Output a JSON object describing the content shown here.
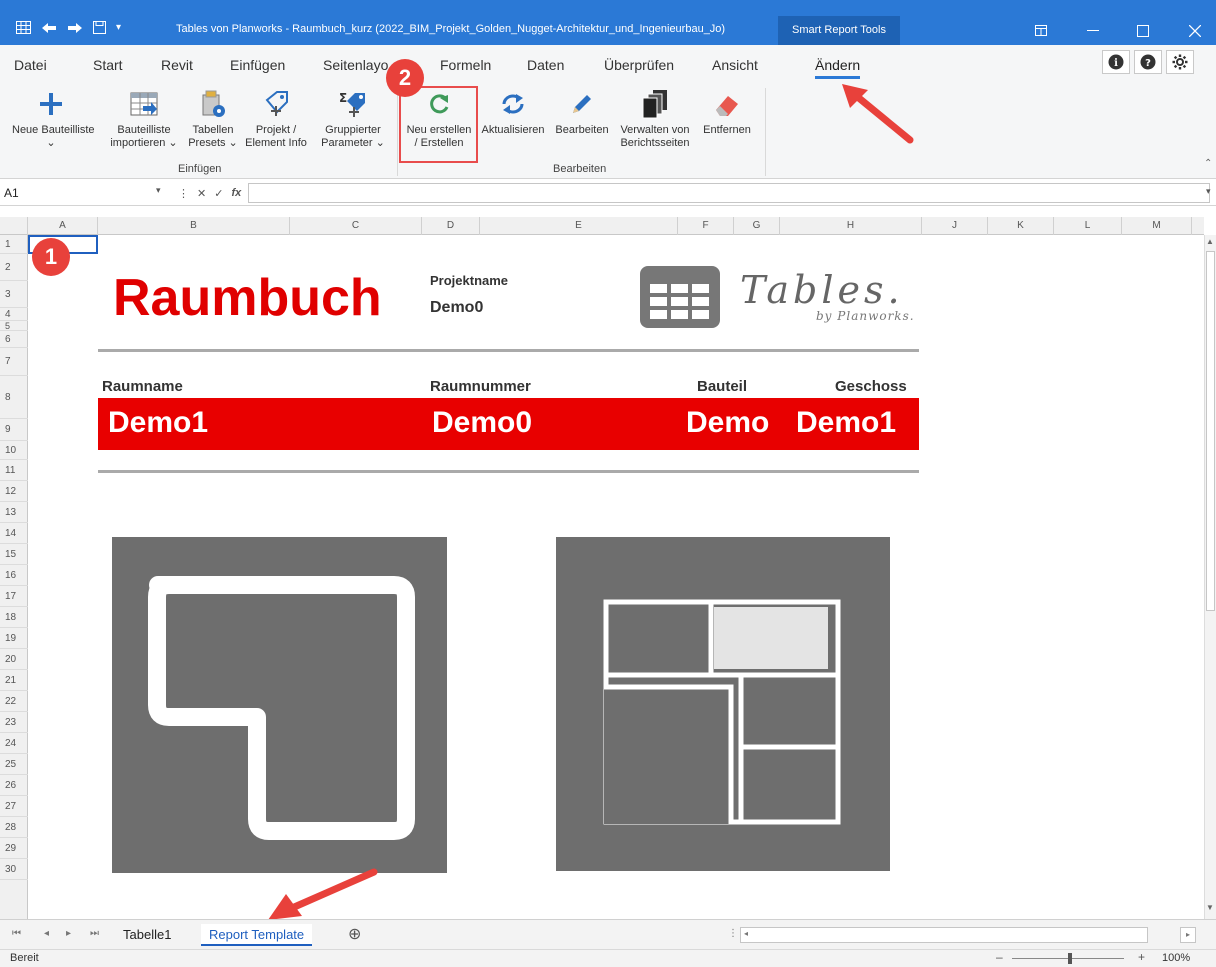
{
  "window": {
    "title": "Tables von Planworks - Raumbuch_kurz  (2022_BIM_Projekt_Golden_Nugget-Architektur_und_Ingenieurbau_Jo)",
    "context_tab": "Smart Report Tools"
  },
  "ribbon_tabs": [
    "Datei",
    "Start",
    "Revit",
    "Einfügen",
    "Seitenlayo",
    "Formeln",
    "Daten",
    "Überprüfen",
    "Ansicht",
    "Ändern"
  ],
  "active_tab": "Ändern",
  "groups": {
    "einfuegen": {
      "label": "Einfügen",
      "buttons": [
        {
          "line1": "Neue Bauteilliste",
          "line2": "⌄"
        },
        {
          "line1": "Bauteilliste",
          "line2": "importieren ⌄"
        },
        {
          "line1": "Tabellen",
          "line2": "Presets ⌄"
        },
        {
          "line1": "Projekt /",
          "line2": "Element Info"
        },
        {
          "line1": "Gruppierter",
          "line2": "Parameter ⌄"
        }
      ]
    },
    "bearbeiten": {
      "label": "Bearbeiten",
      "buttons": [
        {
          "line1": "Neu erstellen",
          "line2": "/ Erstellen"
        },
        {
          "line1": "Aktualisieren",
          "line2": ""
        },
        {
          "line1": "Bearbeiten",
          "line2": ""
        },
        {
          "line1": "Verwalten von",
          "line2": "Berichtsseiten"
        },
        {
          "line1": "Entfernen",
          "line2": ""
        }
      ]
    }
  },
  "formula_bar": {
    "name_box": "A1",
    "formula": ""
  },
  "columns": [
    "A",
    "B",
    "C",
    "D",
    "E",
    "F",
    "G",
    "H",
    "J",
    "K",
    "L",
    "M"
  ],
  "rows": [
    "1",
    "2",
    "3",
    "4",
    "5",
    "6",
    "7",
    "8",
    "9",
    "10",
    "11",
    "12",
    "13",
    "14",
    "15",
    "16",
    "17",
    "18",
    "19",
    "20",
    "21",
    "22",
    "23",
    "24",
    "25",
    "26",
    "27",
    "28",
    "29",
    "30"
  ],
  "report": {
    "title": "Raumbuch",
    "projektname_label": "Projektname",
    "projektname_value": "Demo0",
    "logo_word": "Tables.",
    "logo_sub": "by Planworks.",
    "headers": {
      "raumname": "Raumname",
      "raumnummer": "Raumnummer",
      "bauteil": "Bauteil",
      "geschoss": "Geschoss"
    },
    "values": {
      "raumname": "Demo1",
      "raumnummer": "Demo0",
      "bauteil": "Demo",
      "geschoss": "Demo1"
    }
  },
  "annotations": {
    "badge1": "1",
    "badge2": "2"
  },
  "sheet_tabs": [
    "Tabelle1",
    "Report Template"
  ],
  "active_sheet": "Report Template",
  "status": {
    "left": "Bereit",
    "zoom": "100%"
  },
  "colors": {
    "title_bar": "#2b79d6",
    "accent_red": "#e00000",
    "annotation_red": "#e84c4c",
    "image_grey": "#6e6e6e"
  }
}
